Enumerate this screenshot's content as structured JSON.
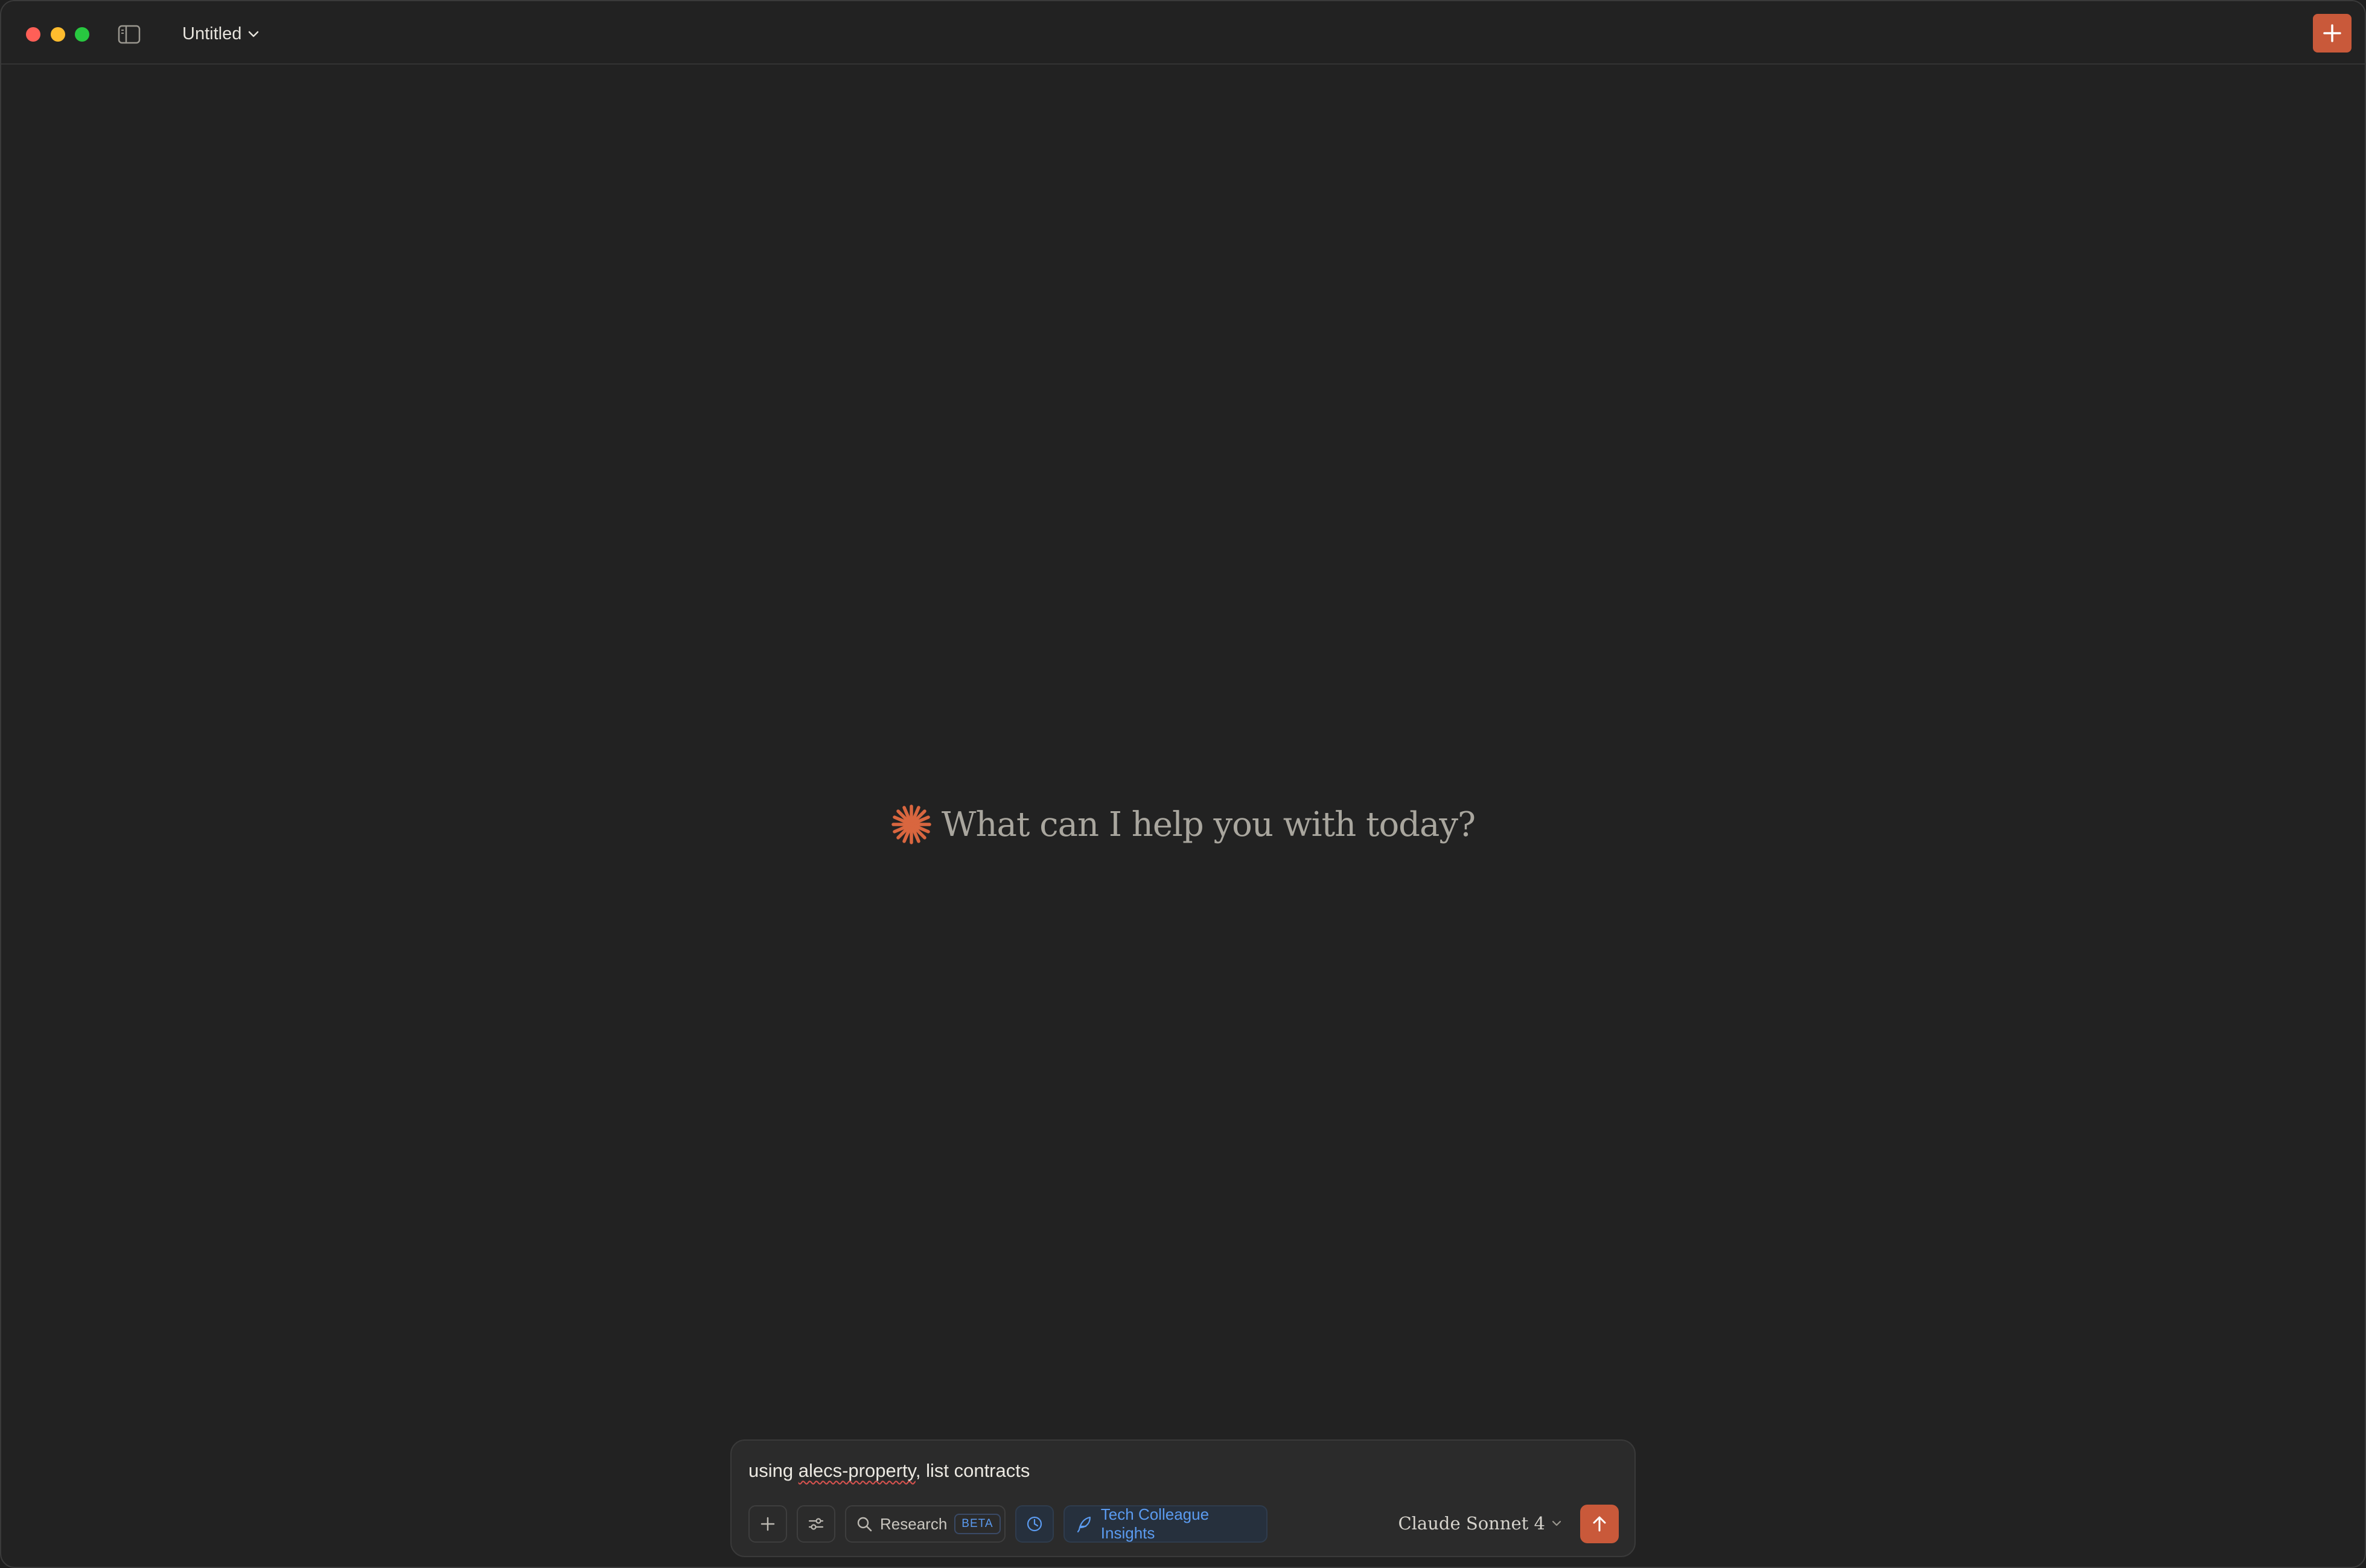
{
  "window": {
    "title": "Untitled"
  },
  "hero": {
    "greeting": "What can I help you with today?"
  },
  "composer": {
    "prompt_before": "using ",
    "prompt_misspelled": "alecs-property",
    "prompt_after": ", list contracts",
    "research_label": "Research",
    "research_badge": "BETA",
    "insights_label": "Tech Colleague Insights",
    "model_label": "Claude Sonnet 4"
  },
  "colors": {
    "accent": "#c9593a",
    "link_blue": "#5b9bf0",
    "background": "#222222"
  },
  "icons": {
    "sidebar_toggle": "sidebar-icon",
    "new_chat": "plus-icon",
    "attach": "plus-icon",
    "tools": "sliders-icon",
    "research": "search-icon",
    "clock": "clock-icon",
    "insights": "feather-icon",
    "send": "arrow-up-icon",
    "logo": "claude-spark-icon"
  }
}
